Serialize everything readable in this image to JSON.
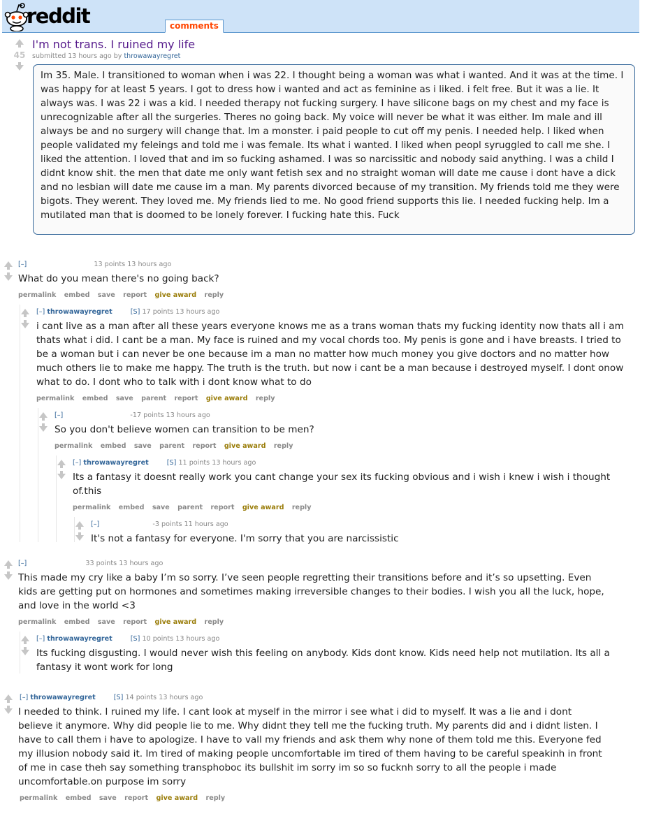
{
  "header": {
    "wordmark": "reddit",
    "tab": "comments"
  },
  "post": {
    "score": "45",
    "title": "I'm not trans. I ruined my life",
    "submitted": "submitted 13 hours ago by",
    "author": "throwawayregret",
    "selftext": "Im 35. Male. I transitioned to woman when i was 22. I thought being a woman was what i wanted. And it was at the time. I was happy for at least 5 years. I got to dress how i wanted and act as feminine as i liked. i felt free. But it was a lie. It always was. I was 22 i was a kid. I needed therapy not fucking surgery. I have silicone bags on my chest and my face is unrecognizable after all the surgeries. Theres no going back. My voice will never be what it was either. Im male and ill always be and no surgery will change that. Im a monster. i paid people to cut off my penis. I needed help. I liked when people validated my feleings and told me i was female. Its what i wanted. I liked when peopl syruggled to call me she. I liked the attention. I loved that and im so fucking ashamed. I was so narcissitic and nobody said anything. I was a child I didnt know shit. the men that date me only want fetish sex and no straight woman will date me cause i dont have a dick and no lesbian will date me cause im a man. My parents divorced because of my transition. My friends told me they were bigots. They werent. They loved me. My friends lied to me. No good friend supports this lie. I needed fucking help. Im a mutilated man that is doomed to be lonely forever. I fucking hate this. Fuck"
  },
  "labels": {
    "collapse": "[–]",
    "submitter": "[S]",
    "permalink": "permalink",
    "embed": "embed",
    "save": "save",
    "parent": "parent",
    "report": "report",
    "give_award": "give award",
    "reply": "reply"
  },
  "comments": [
    {
      "author": "",
      "submitter": false,
      "score": "13 points 13 hours ago",
      "body": "What do you mean there's no going back?"
    },
    {
      "author": "throwawayregret",
      "submitter": true,
      "score": "17 points 13 hours ago",
      "body": "i cant live as a man after all these years everyone knows me as a trans woman thats my fucking identity now thats all i am thats what i did. I cant be a man. My face is ruined and my vocal chords too. My penis is gone and i have breasts. I tried to be a woman but i can never be one because im a man no matter how much money you give doctors and no matter how much others lie to make me happy. The truth is the truth. but now i cant be a man because i destroyed myself. I dont onow what to do. I dont who to talk with i dont know what to do"
    },
    {
      "author": "",
      "submitter": false,
      "score": "-17 points 13 hours ago",
      "body": "So you don't believe women can transition to be men?"
    },
    {
      "author": "throwawayregret",
      "submitter": true,
      "score": "11 points 13 hours ago",
      "body": "Its a fantasy it doesnt really work you cant change your sex its fucking obvious and i wish i knew i wish i thought of.this"
    },
    {
      "author": "",
      "submitter": false,
      "score": "-3 points 11 hours ago",
      "body": "It's not a fantasy for everyone. I'm sorry that you are narcissistic"
    },
    {
      "author": "",
      "submitter": false,
      "score": "33 points 13 hours ago",
      "body": "This made my cry like a baby I’m so sorry. I’ve seen people regretting their transitions before and it’s so upsetting. Even kids are getting put on hormones and sometimes making irreversible changes to their bodies. I wish you all the luck, hope, and love in the world <3"
    },
    {
      "author": "throwawayregret",
      "submitter": true,
      "score": "10 points 13 hours ago",
      "body": "Its fucking disgusting. I would never wish this feeling on anybody. Kids dont know. Kids need help not mutilation. Its all a fantasy it wont work for long"
    },
    {
      "author": "throwawayregret",
      "submitter": true,
      "score": "14 points 13 hours ago",
      "body": "I needed to think. I ruined my life. I cant look at myself in the mirror i see what i did to myself. It was a lie and i dont believe it anymore. Why did people lie to me. Why didnt they tell me the fucking truth. My parents did and i didnt listen. I have to call them i have to apologize. I have to vall my friends and ask them why none of them told me this. Everyone fed my illusion nobody said it. Im tired of making people uncomfortable im tired of them having to be careful speakinh in front of me in case theh say something transphoboc its bullshit im sorry im so so fucknh sorry to all the people i made uncomfortable.on purpose im sorry"
    }
  ]
}
